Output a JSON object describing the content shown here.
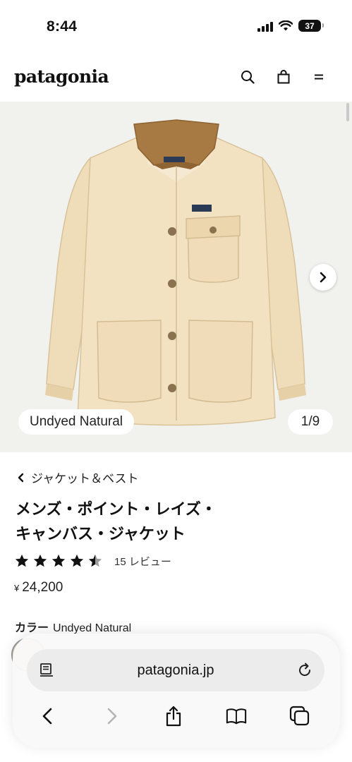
{
  "status": {
    "time": "8:44",
    "battery": "37"
  },
  "header": {
    "logo": "patagonia"
  },
  "hero": {
    "color_chip": "Undyed Natural",
    "pager": "1/9"
  },
  "product": {
    "breadcrumb": "ジャケット＆ベスト",
    "title_line1": "メンズ・ポイント・レイズ・",
    "title_line2": "キャンバス・ジャケット",
    "rating": 4.5,
    "review_count": "15 レビュー",
    "currency": "¥",
    "price": "24,200",
    "color_label": "カラー",
    "color_value": "Undyed Natural"
  },
  "browser": {
    "url": "patagonia.jp"
  },
  "icons": {
    "search": "search-icon",
    "bag": "shopping-bag-icon",
    "menu": "menu-icon",
    "next": "chevron-right-icon",
    "back": "chevron-left-icon",
    "share": "share-icon",
    "bookmarks": "book-icon",
    "tabs": "tabs-icon",
    "reload": "reload-icon",
    "reader": "reader-icon"
  }
}
